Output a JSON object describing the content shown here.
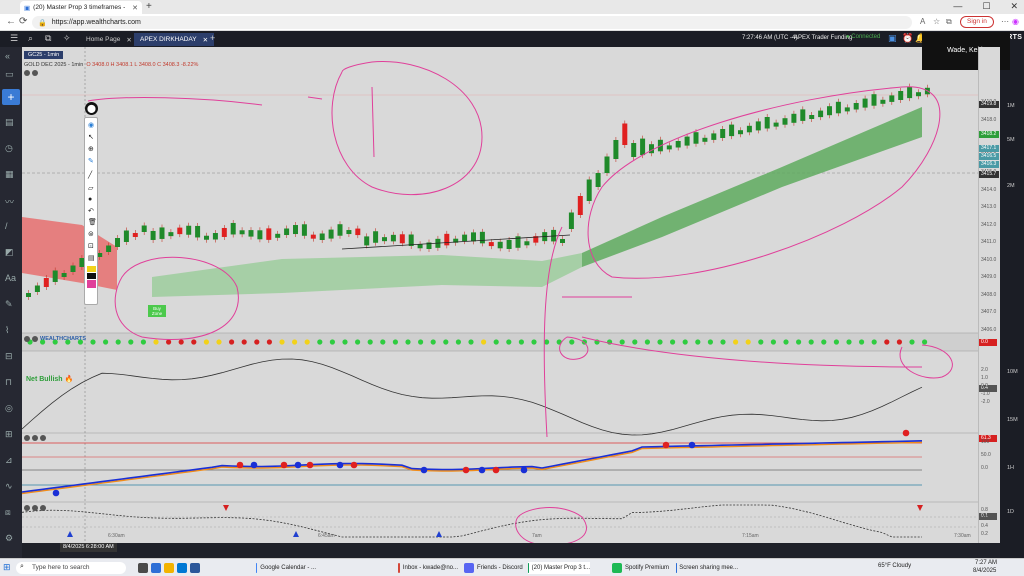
{
  "browser": {
    "tab_title": "(20) Master Prop 3 timeframes -",
    "url": "https://app.wealthcharts.com",
    "signin_label": "Sign in"
  },
  "app": {
    "tabs": [
      {
        "label": "Home Page"
      },
      {
        "label": "APEX DIRKHADAY"
      }
    ],
    "time": "7:27:46 AM (UTC -4)",
    "funding": "APEX Trader Funding",
    "connection": "Connected",
    "brand": "WEALTHCHARTS"
  },
  "chart": {
    "symbol_tag": "GC25 - 1min",
    "instrument": "GOLD DEC 2025 - 1min",
    "ohlc_values": "O 3408.0  H 3408.1  L 3408.0  C 3408.3  -8.22%",
    "user_name": "Wade, Keith",
    "price_ticks": [
      "3419.0",
      "3418.0",
      "3417.0",
      "3416.0",
      "3415.0",
      "3414.0",
      "3413.0",
      "3412.0",
      "3411.0",
      "3410.0",
      "3409.0",
      "3408.0",
      "3407.0",
      "3406.0"
    ],
    "price_tags": [
      {
        "label": "3419.8",
        "color": "#333333"
      },
      {
        "label": "3418.2",
        "color": "#2e9e3a"
      },
      {
        "label": "3417.1",
        "color": "#4a9aa5"
      },
      {
        "label": "3416.5",
        "color": "#4a9aa5"
      },
      {
        "label": "3416.3",
        "color": "#4a9aa5"
      },
      {
        "label": "3415.7",
        "color": "#333333"
      }
    ],
    "time_labels": [
      "6:30am",
      "6:45am",
      "7am",
      "7:15am",
      "7:30am"
    ],
    "crosshair_time": "8/4/2025 6:28:00 AM",
    "right_scale_labels": [
      "1M",
      "5M",
      "2M",
      "10M",
      "15M",
      "1H",
      "1D"
    ],
    "buy_zone_label": "Buy Zone"
  },
  "indicators": {
    "dots_label": "WEALTHCHARTS",
    "net_bullish": "Net Bullish",
    "dots_tag": "0.0",
    "osc_tag": "0.4",
    "rsi_tag": "61.3",
    "bottom_tag": "0.1",
    "osc_ticks": [
      "2.0",
      "1.0",
      "0.0",
      "-1.0",
      "-2.0"
    ],
    "rsi_ticks": [
      "100",
      "50.0",
      "0.0"
    ],
    "bot_ticks": [
      "0.8",
      "0.6",
      "0.4",
      "0.2"
    ],
    "dot_colors": {
      "green": "#2ecc40",
      "red": "#d62020",
      "yellow": "#f2d21a"
    }
  },
  "taskbar": {
    "search_placeholder": "Type here to search",
    "apps": [
      {
        "label": "Google Calendar - ...",
        "color": "#4285f4"
      },
      {
        "label": "Inbox - kwade@no...",
        "color": "#d44638"
      },
      {
        "label": "Friends - Discord",
        "color": "#5865f2"
      },
      {
        "label": "(20) Master Prop 3 t...",
        "color": "#0f9d58"
      },
      {
        "label": "Spotify Premium",
        "color": "#1db954"
      },
      {
        "label": "Screen sharing mee...",
        "color": "#2d6fd6"
      }
    ],
    "weather": "65°F Cloudy",
    "clock_time": "7:27 AM",
    "clock_date": "8/4/2025"
  }
}
